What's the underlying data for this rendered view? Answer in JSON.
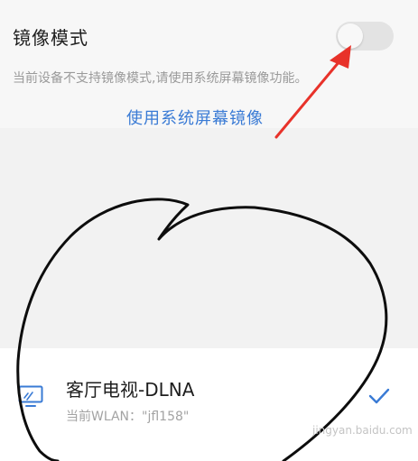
{
  "mirror": {
    "title": "镜像模式",
    "toggle_on": false,
    "hint": "当前设备不支持镜像模式,请使用系统屏幕镜像功能。",
    "system_mirror_link": "使用系统屏幕镜像"
  },
  "device": {
    "icon": "tv-screen-icon",
    "name": "客厅电视-DLNA",
    "wlan": "当前WLAN：\"jfl158\"",
    "selected": true,
    "check_icon": "checkmark-icon"
  },
  "colors": {
    "accent": "#3a7bd5",
    "annotation_arrow": "#e8322a"
  },
  "watermark": "jingyan.baidu.com"
}
